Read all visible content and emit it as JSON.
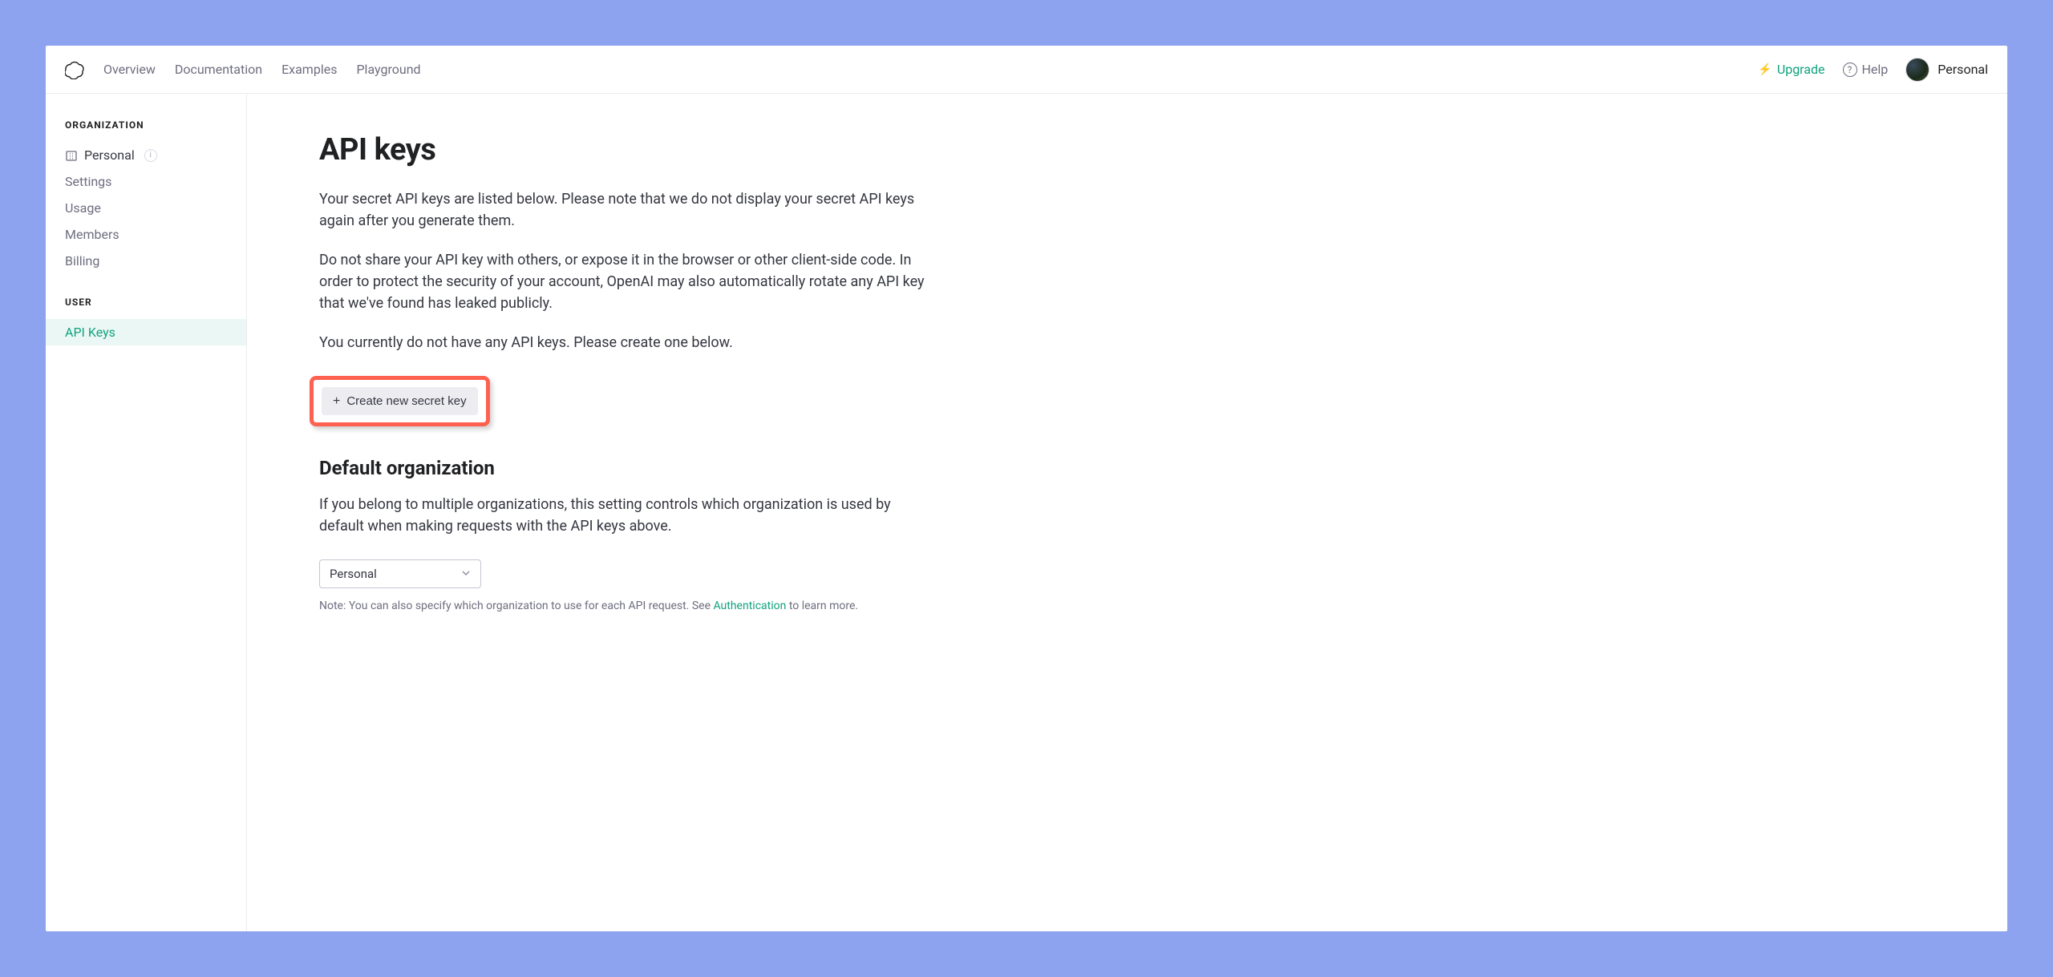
{
  "nav": {
    "links": {
      "overview": "Overview",
      "documentation": "Documentation",
      "examples": "Examples",
      "playground": "Playground"
    },
    "upgrade": "Upgrade",
    "help": "Help",
    "account_label": "Personal"
  },
  "sidebar": {
    "org_title": "ORGANIZATION",
    "org_name": "Personal",
    "items": {
      "settings": "Settings",
      "usage": "Usage",
      "members": "Members",
      "billing": "Billing"
    },
    "user_title": "USER",
    "user_items": {
      "api_keys": "API Keys"
    }
  },
  "main": {
    "title": "API keys",
    "p1": "Your secret API keys are listed below. Please note that we do not display your secret API keys again after you generate them.",
    "p2": "Do not share your API key with others, or expose it in the browser or other client-side code. In order to protect the security of your account, OpenAI may also automatically rotate any API key that we've found has leaked publicly.",
    "p3": "You currently do not have any API keys. Please create one below.",
    "create_label": "Create new secret key",
    "default_org_title": "Default organization",
    "default_org_desc": "If you belong to multiple organizations, this setting controls which organization is used by default when making requests with the API keys above.",
    "org_select_value": "Personal",
    "note_prefix": "Note: You can also specify which organization to use for each API request. See ",
    "note_link": "Authentication",
    "note_suffix": " to learn more."
  }
}
